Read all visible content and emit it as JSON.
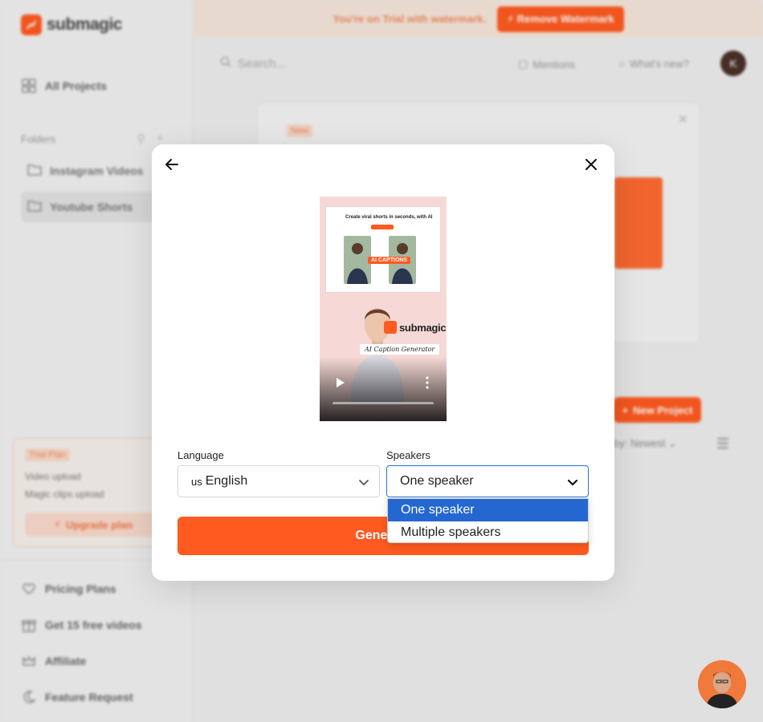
{
  "app": {
    "brand": "submagic",
    "brand_color": "#ff5a1f"
  },
  "sidebar": {
    "all_projects": "All Projects",
    "folders_label": "Folders",
    "folders": [
      {
        "label": "Instagram Videos",
        "active": false
      },
      {
        "label": "Youtube Shorts",
        "active": true
      }
    ],
    "trial": {
      "badge": "Trial Plan",
      "lines": [
        "Video upload",
        "Magic clips upload"
      ],
      "upgrade_label": "Upgrade plan"
    },
    "bottom_items": [
      {
        "label": "Pricing Plans",
        "icon": "heart-icon"
      },
      {
        "label": "Get 15 free videos",
        "icon": "gift-icon"
      },
      {
        "label": "Affiliate",
        "icon": "crown-icon"
      },
      {
        "label": "Feature Request",
        "icon": "moon-icon"
      }
    ]
  },
  "topbar": {
    "trial_text": "You're on Trial with watermark.",
    "remove_label": "Remove Watermark"
  },
  "header": {
    "search_placeholder": "Search...",
    "mentions_label": "Mentions",
    "whats_new_label": "What's new?",
    "avatar_initial": "K"
  },
  "card": {
    "badge": "New"
  },
  "projects": {
    "new_project_label": "New Project",
    "sort_label": "by: Newest"
  },
  "modal": {
    "preview": {
      "page_headline": "Create viral shorts in seconds, with AI",
      "caption_label": "AI CAPTIONS",
      "brand_text": "submagic",
      "subtitle": "AI Caption Generator",
      "progress_fraction": 0.0
    },
    "language": {
      "label": "Language",
      "flag": "us",
      "value": "English"
    },
    "speakers": {
      "label": "Speakers",
      "value": "One speaker",
      "options": [
        "One speaker",
        "Multiple speakers"
      ],
      "selected_index": 0
    },
    "generate_label": "Generate"
  }
}
